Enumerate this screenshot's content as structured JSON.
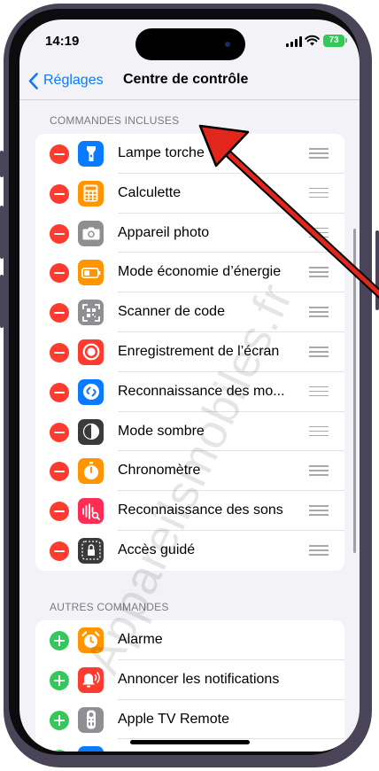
{
  "status_bar": {
    "time": "14:19",
    "battery": "73"
  },
  "nav": {
    "back_label": "Réglages",
    "title": "Centre de contrôle"
  },
  "included": {
    "header": "COMMANDES INCLUSES",
    "items": [
      {
        "label": "Lampe torche",
        "icon": "flashlight-icon",
        "color": "#0a7aff"
      },
      {
        "label": "Calculette",
        "icon": "calculator-icon",
        "color": "#ff9500"
      },
      {
        "label": "Appareil photo",
        "icon": "camera-icon",
        "color": "#8e8e93"
      },
      {
        "label": "Mode économie d’énergie",
        "icon": "battery-saver-icon",
        "color": "#ff9500"
      },
      {
        "label": "Scanner de code",
        "icon": "qr-scanner-icon",
        "color": "#8e8e93"
      },
      {
        "label": "Enregistrement de l’écran",
        "icon": "screen-record-icon",
        "color": "#ff3b30"
      },
      {
        "label": "Reconnaissance des mo...",
        "icon": "shazam-icon",
        "color": "#0a7aff"
      },
      {
        "label": "Mode sombre",
        "icon": "dark-mode-icon",
        "color": "#3a3a3c"
      },
      {
        "label": "Chronomètre",
        "icon": "stopwatch-icon",
        "color": "#ff9500"
      },
      {
        "label": "Reconnaissance des sons",
        "icon": "sound-recognition-icon",
        "color": "#ff2d55"
      },
      {
        "label": "Accès guidé",
        "icon": "guided-access-icon",
        "color": "#3a3a3c"
      }
    ]
  },
  "other": {
    "header": "AUTRES COMMANDES",
    "items": [
      {
        "label": "Alarme",
        "icon": "alarm-icon",
        "color": "#ff9500"
      },
      {
        "label": "Annoncer les notifications",
        "icon": "announce-notifications-icon",
        "color": "#ff3b30"
      },
      {
        "label": "Apple TV Remote",
        "icon": "tv-remote-icon",
        "color": "#8e8e93"
      },
      {
        "label": "",
        "icon": "partial-row-icon",
        "color": "#0a7aff"
      }
    ]
  },
  "watermark": "Appareilsmobiles.fr",
  "colors": {
    "accent": "#0a7aff",
    "remove": "#ff3b30",
    "add": "#34c759",
    "arrow": "#e1261c"
  }
}
